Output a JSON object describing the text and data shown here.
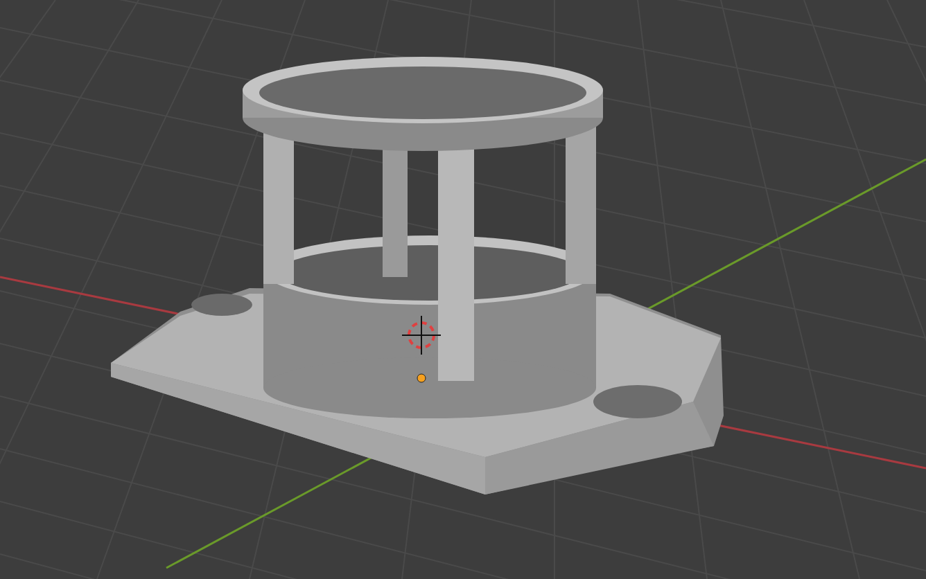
{
  "viewport": {
    "cursor_visible": true,
    "origin_visible": true
  }
}
